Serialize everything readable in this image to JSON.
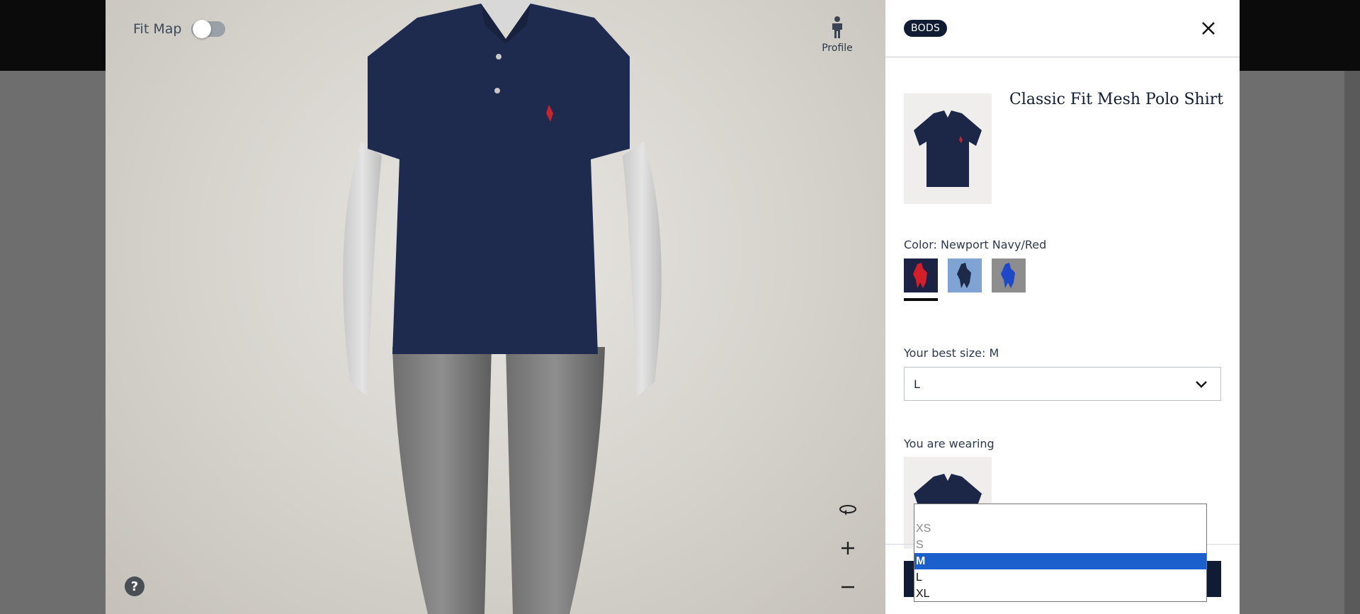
{
  "viewer": {
    "fit_map_label": "Fit Map",
    "profile_label": "Profile",
    "help_label": "?"
  },
  "panel": {
    "brand_logo": "BODS",
    "product_title": "Classic Fit Mesh Polo Shirt",
    "color_label": "Color: Newport Navy/Red",
    "swatches": [
      "Newport Navy/Red",
      "Light Blue",
      "Grey Heather"
    ],
    "best_size_label": "Your best size: M",
    "selected_size": "L",
    "wearing_label": "You are wearing"
  },
  "size_dropdown": {
    "options": [
      "",
      "XS",
      "S",
      "M",
      "L",
      "XL"
    ],
    "highlighted": "M"
  },
  "colors": {
    "navy": "#0f1c33",
    "highlight": "#1a5fcc"
  }
}
